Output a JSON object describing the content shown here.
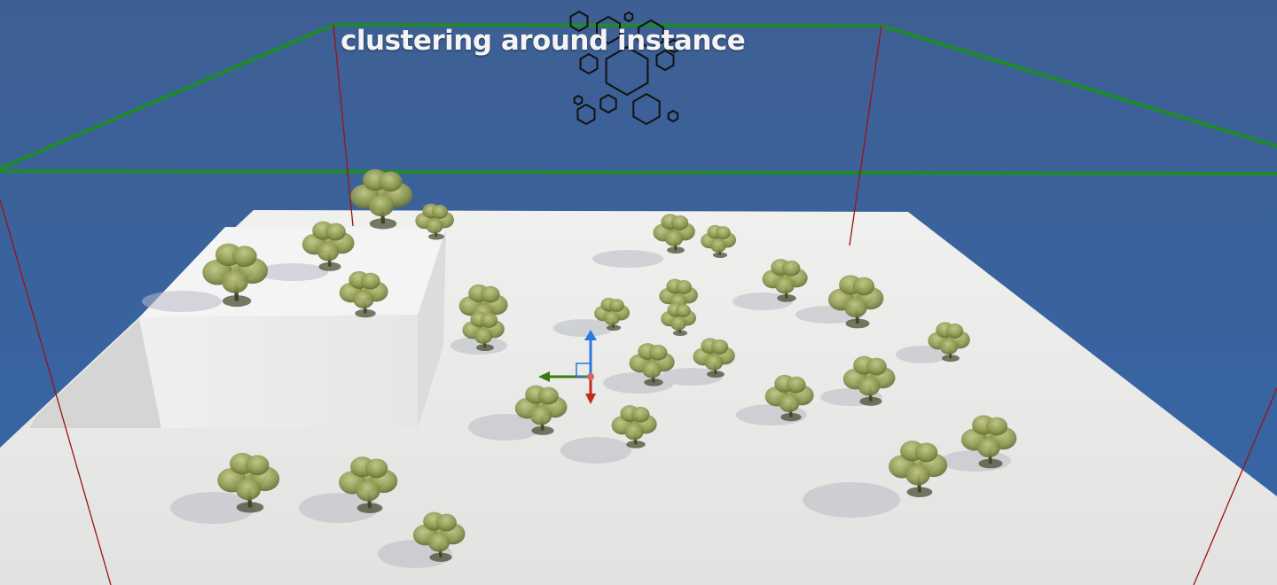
{
  "viewport": {
    "overlay_label": "clustering around instance"
  },
  "icons": {
    "gizmo": "transform-gizmo-icon",
    "cluster": "hexagon-cluster-icon"
  },
  "colors": {
    "sky": "#3f6398",
    "ground": "#e9e9e7",
    "bounds_box": "#1f8a2a",
    "vertical_lines": "#9b1414",
    "foliage": "#8f9a4a",
    "gizmo_x": "#d23b1c",
    "gizmo_y": "#3a7a12",
    "gizmo_z": "#2a78e0"
  }
}
